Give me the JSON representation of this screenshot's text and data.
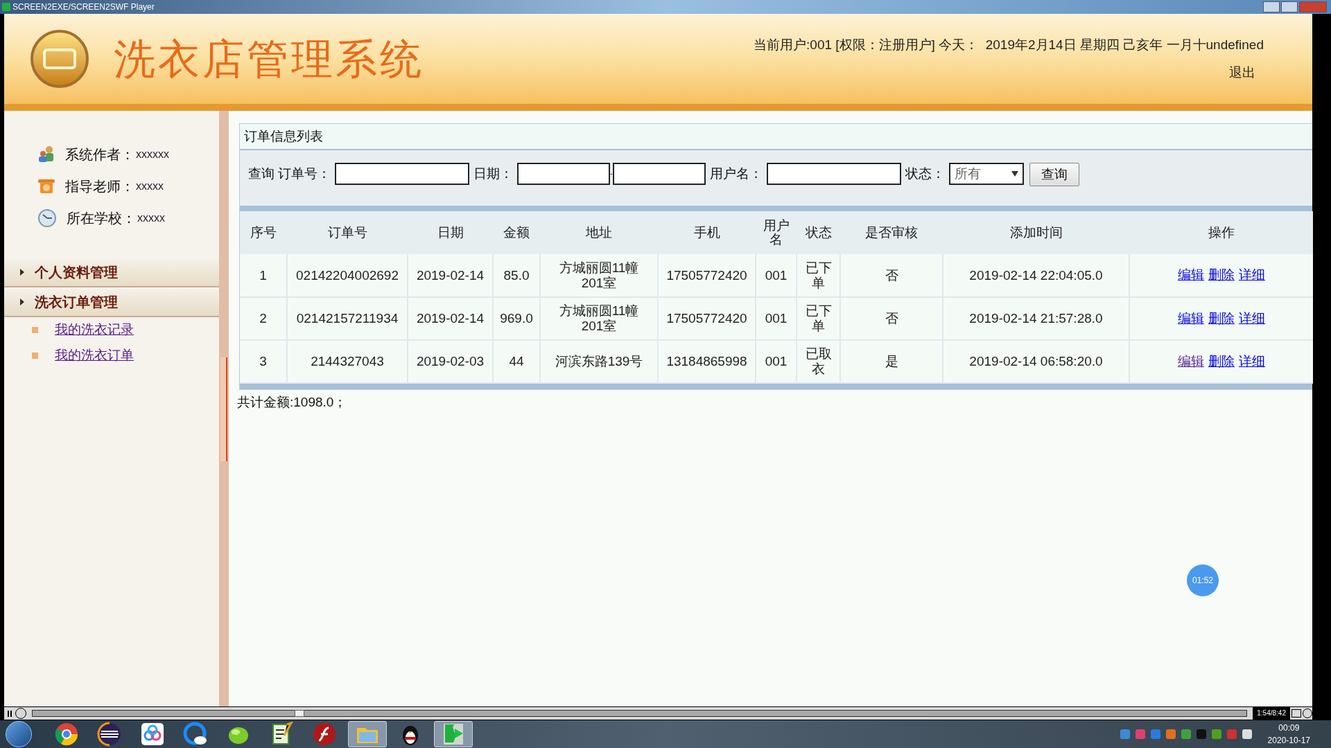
{
  "player": {
    "title": "SCREEN2EXE/SCREEN2SWF Player",
    "time": "1:54/8:42",
    "level": 0.22
  },
  "header": {
    "title": "洗衣店管理系统",
    "user_info": "当前用户:001 [权限：注册用户] 今天：  2019年2月14日 星期四 己亥年 一月十undefined",
    "logout": "退出"
  },
  "sidebar": {
    "info": [
      {
        "kind": "people",
        "label": "系统作者：",
        "value": "xxxxxx"
      },
      {
        "kind": "phone",
        "label": "指导老师：",
        "value": "xxxxx"
      },
      {
        "kind": "clock",
        "label": "所在学校：",
        "value": "xxxxx"
      }
    ],
    "menus": [
      {
        "label": "个人资料管理"
      },
      {
        "label": "洗衣订单管理",
        "children": [
          {
            "label": "我的洗衣记录",
            "visited": true
          },
          {
            "label": "我的洗衣订单",
            "visited": true
          }
        ]
      }
    ]
  },
  "panel": {
    "title": "订单信息列表",
    "search": {
      "order_label": "查询 订单号：",
      "date_label": "日期：",
      "date_separator": "-",
      "user_label": "用户名：",
      "status_label": "状态：",
      "status_value": "所有",
      "button": "查询"
    },
    "table": {
      "columns": [
        "序号",
        "订单号",
        "日期",
        "金额",
        "地址",
        "手机",
        "用户名",
        "状态",
        "是否审核",
        "添加时间",
        "操作"
      ],
      "rows": [
        {
          "cells": [
            "1",
            "02142204002692",
            "2019-02-14",
            "85.0",
            "方城丽圆11幢201室",
            "17505772420",
            "001",
            "已下单",
            "否",
            "2019-02-14 22:04:05.0"
          ],
          "actions": [
            {
              "label": "编辑",
              "visited": false
            },
            {
              "label": "删除",
              "visited": false
            },
            {
              "label": "详细",
              "visited": false
            }
          ]
        },
        {
          "cells": [
            "2",
            "02142157211934",
            "2019-02-14",
            "969.0",
            "方城丽圆11幢201室",
            "17505772420",
            "001",
            "已下单",
            "否",
            "2019-02-14 21:57:28.0"
          ],
          "actions": [
            {
              "label": "编辑",
              "visited": false
            },
            {
              "label": "删除",
              "visited": false
            },
            {
              "label": "详细",
              "visited": false
            }
          ]
        },
        {
          "cells": [
            "3",
            "2144327043",
            "2019-02-03",
            "44",
            "河滨东路139号",
            "13184865998",
            "001",
            "已取衣",
            "是",
            "2019-02-14 06:58:20.0"
          ],
          "actions": [
            {
              "label": "编辑",
              "visited": true
            },
            {
              "label": "删除",
              "visited": false
            },
            {
              "label": "详细",
              "visited": false
            }
          ]
        }
      ]
    },
    "total": "共计金额:1098.0；"
  },
  "timer_badge": "01:52",
  "taskbar": {
    "apps": [
      {
        "kind": "browser",
        "active": false
      },
      {
        "kind": "ide",
        "active": false
      },
      {
        "kind": "cloud",
        "active": false
      },
      {
        "kind": "chat",
        "active": false
      },
      {
        "kind": "leaf",
        "active": false
      },
      {
        "kind": "notepad",
        "active": false
      },
      {
        "kind": "flash",
        "active": false
      },
      {
        "kind": "folder",
        "active": true
      },
      {
        "kind": "penguin",
        "active": false
      },
      {
        "kind": "player",
        "active": true
      }
    ],
    "clock_time": "00:09",
    "clock_date": "2020-10-17"
  }
}
